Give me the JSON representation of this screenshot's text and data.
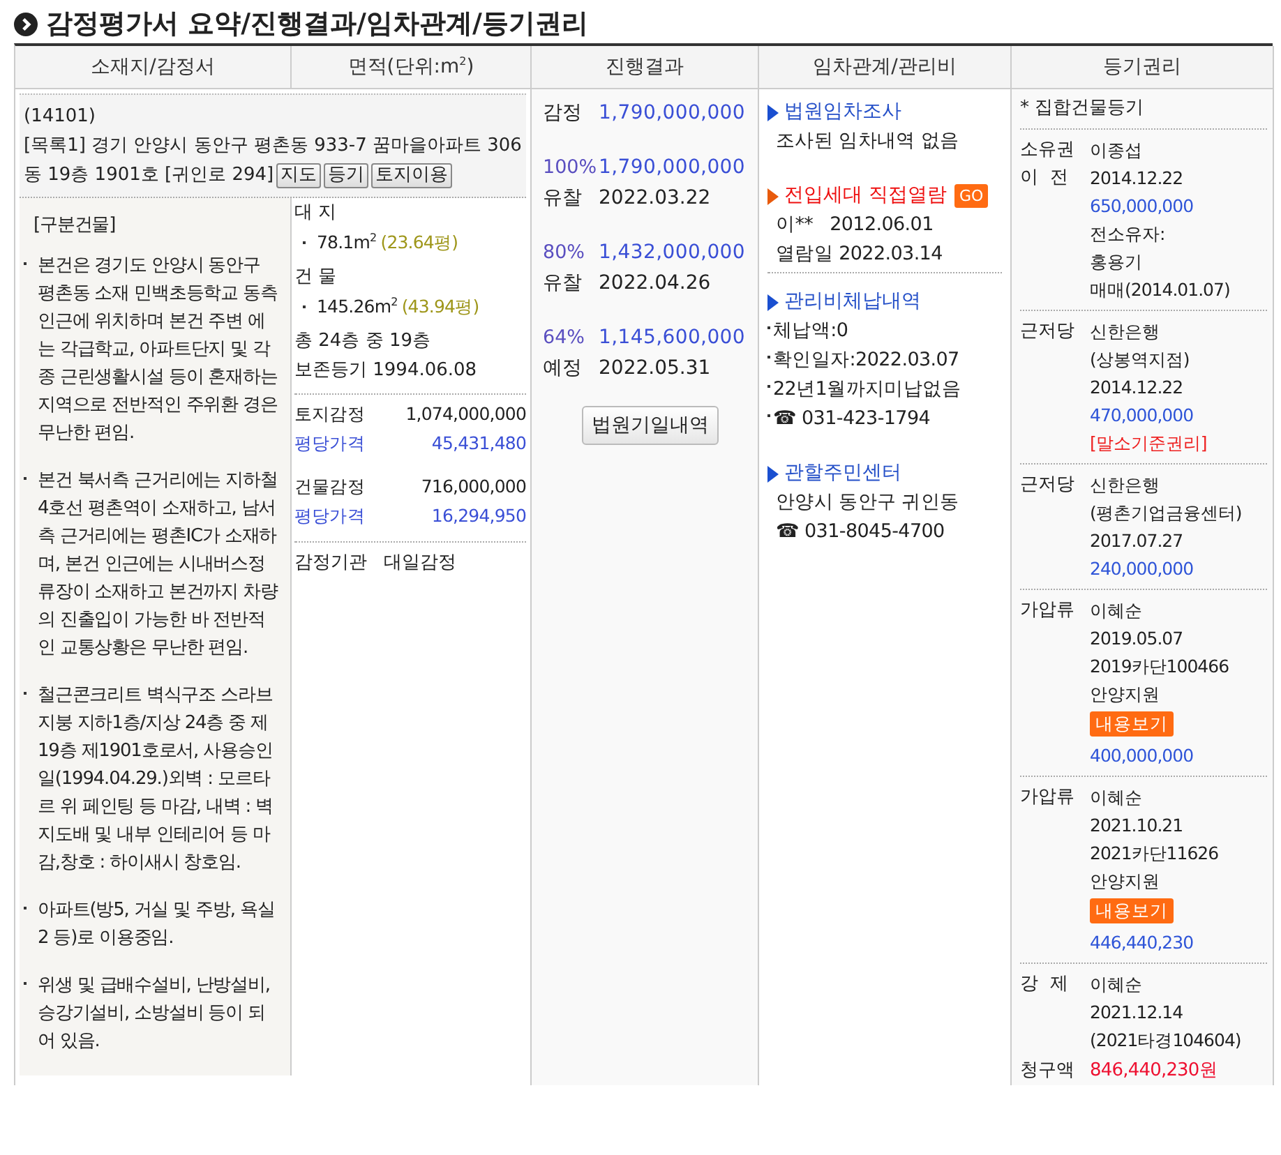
{
  "title": "감정평가서 요약/진행결과/임차관계/등기권리",
  "columns": [
    "소재지/감정서",
    "면적(단위:m$^{2}$)",
    "진행결과",
    "임차관계/관리비",
    "등기권리"
  ],
  "address": {
    "postcode": "(14101)",
    "lines": [
      "[목록1] 경기 안양시 동안구 평촌동 933-7 꿈마을아파트 306",
      "동 19층 1901호 [귀인로 294]"
    ],
    "buttons": [
      "지도",
      "등기",
      "토지이용"
    ]
  },
  "building": {
    "heading": "[구분건물]",
    "paragraphs": [
      "본건은 경기도 안양시 동안구 평촌동 소재 민백초등학교 동측 인근에 위치하며 본건 주변 에는 각급학교, 아파트단지 및 각종 근린생활시설 등이 혼재하는 지역으로 전반적인 주위환 경은 무난한 편임.",
      "본건 북서측 근거리에는 지하철 4호선 평촌역이 소재하고, 남서측 근거리에는 평촌IC가 소재하며, 본건 인근에는 시내버스정류장이 소재하고 본건까지 차량의 진출입이 가능한 바 전반적인 교통상황은 무난한 편임.",
      "철근콘크리트 벽식구조 스라브지붕 지하1층/지상 24층 중 제19층 제1901호로서, 사용승인일(1994.04.29.)외벽 : 모르타르 위 페인팅 등 마감, 내벽 : 벽지도배 및 내부 인테리어 등 마감,창호 : 하이새시 창호임.",
      "아파트(방5, 거실 및 주방, 욕실2 등)로 이용중임.",
      "위생 및 급배수설비, 난방설비, 승강기설비, 소방설비 등이 되어 있음."
    ]
  },
  "area": {
    "sections": [
      {
        "label": "대 지",
        "size": "78.1m$^{2}$",
        "pyeong": "(23.64평)"
      },
      {
        "label": "건 물",
        "size": "145.26m$^{2}$",
        "pyeong": "(43.94평)"
      }
    ],
    "floors": "총 24층 중 19층",
    "registration": "보존등기 1994.06.08",
    "appraisals": [
      {
        "label": "토지감정",
        "value": "1,074,000,000",
        "unit_label": "평당가격",
        "unit_value": "45,431,480"
      },
      {
        "label": "건물감정",
        "value": "716,000,000",
        "unit_label": "평당가격",
        "unit_value": "16,294,950"
      }
    ],
    "appraiser": {
      "label": "감정기관",
      "value": "대일감정"
    }
  },
  "progress": {
    "appraisal": {
      "label": "감정",
      "value": "1,790,000,000"
    },
    "rounds": [
      {
        "percent": "100%",
        "price": "1,790,000,000",
        "status": "유찰",
        "date": "2022.03.22"
      },
      {
        "percent": "80%",
        "price": "1,432,000,000",
        "status": "유찰",
        "date": "2022.04.26"
      },
      {
        "percent": "64%",
        "price": "1,145,600,000",
        "status": "예정",
        "date": "2022.05.31"
      }
    ],
    "button": "법원기일내역"
  },
  "tenancy": [
    {
      "kind": "link",
      "title": "법원임차조사",
      "lines": [
        "조사된 임차내역 없음"
      ]
    },
    {
      "kind": "alert",
      "title": "전입세대 직접열람",
      "badge": "GO",
      "lines": [
        "이**   2012.06.01",
        "열람일 2022.03.14"
      ]
    },
    {
      "kind": "list",
      "title": "관리비체납내역",
      "lines": [
        "체납액:0",
        "확인일자:2022.03.07",
        "22년1월까지미납없음",
        "☎ 031-423-1794"
      ]
    },
    {
      "kind": "link",
      "title": "관할주민센터",
      "lines": [
        "안양시 동안구 귀인동",
        "☎ 031-8045-4700"
      ]
    }
  ],
  "registry": {
    "note": "* 집합건물등기",
    "entries": [
      {
        "labels": [
          "소유권",
          "이  전"
        ],
        "lines": [
          {
            "kind": "text",
            "text": "이종섭"
          },
          {
            "kind": "text",
            "text": "2014.12.22"
          },
          {
            "kind": "amount",
            "text": "650,000,000"
          },
          {
            "kind": "text",
            "text": "전소유자:"
          },
          {
            "kind": "text",
            "text": "홍용기"
          },
          {
            "kind": "text",
            "text": "매매(2014.01.07)"
          }
        ]
      },
      {
        "labels": [
          "근저당"
        ],
        "lines": [
          {
            "kind": "text",
            "text": "신한은행"
          },
          {
            "kind": "text",
            "text": "(상봉역지점)"
          },
          {
            "kind": "text",
            "text": "2014.12.22"
          },
          {
            "kind": "amount",
            "text": "470,000,000"
          },
          {
            "kind": "warning",
            "text": "[말소기준권리]"
          }
        ]
      },
      {
        "labels": [
          "근저당"
        ],
        "lines": [
          {
            "kind": "text",
            "text": "신한은행"
          },
          {
            "kind": "text",
            "text": "(평촌기업금융센터)"
          },
          {
            "kind": "text",
            "text": "2017.07.27"
          },
          {
            "kind": "amount",
            "text": "240,000,000"
          }
        ]
      },
      {
        "labels": [
          "가압류"
        ],
        "lines": [
          {
            "kind": "text",
            "text": "이혜순"
          },
          {
            "kind": "text",
            "text": "2019.05.07"
          },
          {
            "kind": "text",
            "text": "2019카단100466"
          },
          {
            "kind": "text",
            "text": "안양지원"
          },
          {
            "kind": "button",
            "text": "내용보기"
          },
          {
            "kind": "amount",
            "text": "400,000,000"
          }
        ]
      },
      {
        "labels": [
          "가압류"
        ],
        "lines": [
          {
            "kind": "text",
            "text": "이혜순"
          },
          {
            "kind": "text",
            "text": "2021.10.21"
          },
          {
            "kind": "text",
            "text": "2021카단11626"
          },
          {
            "kind": "text",
            "text": "안양지원"
          },
          {
            "kind": "button",
            "text": "내용보기"
          },
          {
            "kind": "amount",
            "text": "446,440,230"
          }
        ]
      },
      {
        "labels": [
          "강  제"
        ],
        "lines": [
          {
            "kind": "text",
            "text": "이혜순"
          },
          {
            "kind": "text",
            "text": "2021.12.14"
          },
          {
            "kind": "text",
            "text": "(2021타경104604)"
          }
        ],
        "claim": {
          "label": "청구액",
          "amount": "846,440,230원"
        }
      }
    ]
  }
}
